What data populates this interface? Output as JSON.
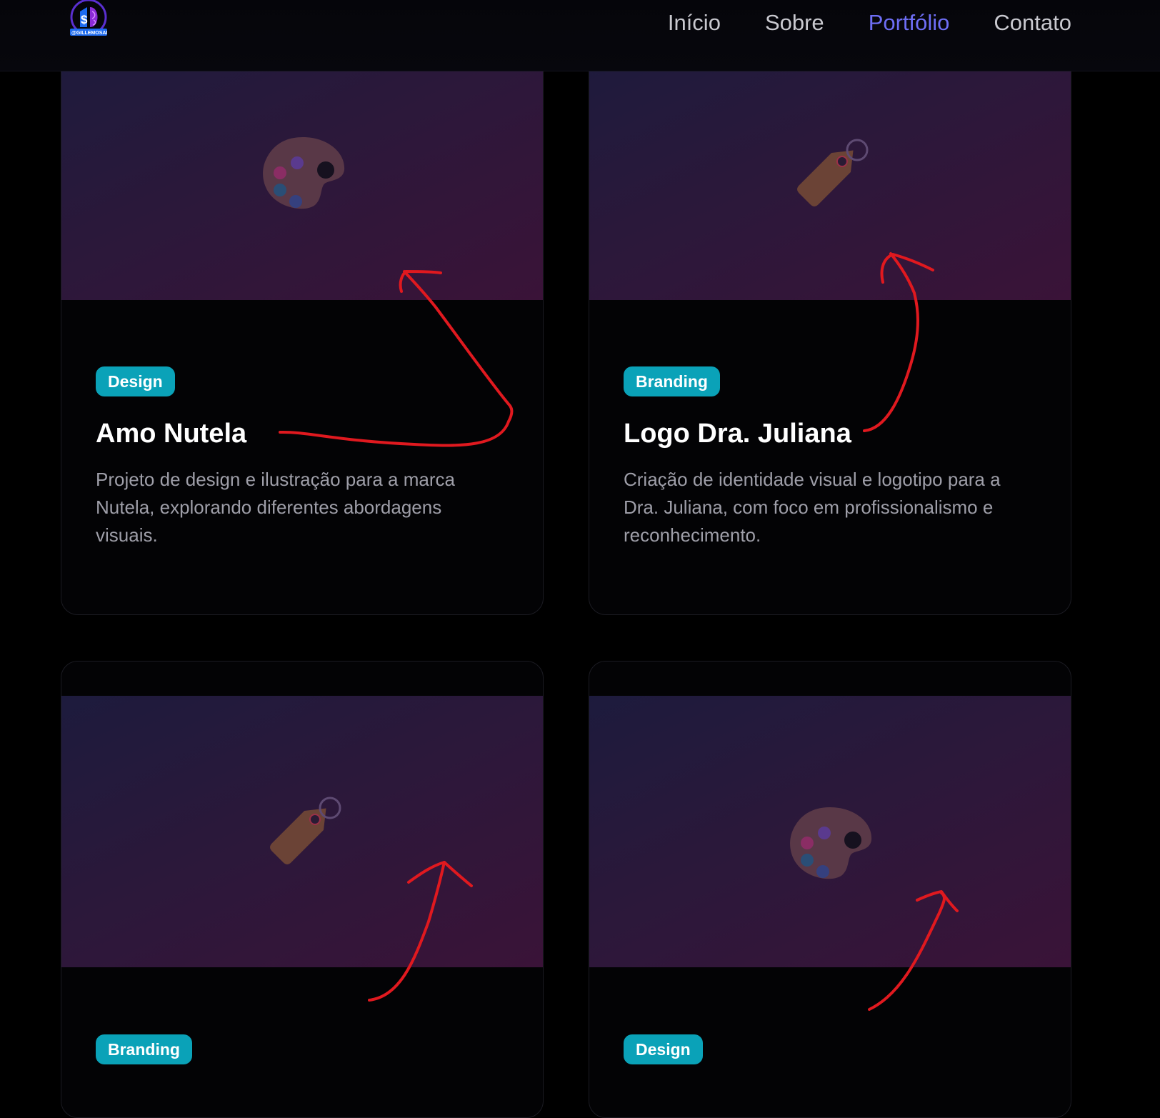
{
  "header": {
    "logo_text": "@GILLEMOSAI",
    "nav": [
      {
        "label": "Início",
        "active": false
      },
      {
        "label": "Sobre",
        "active": false
      },
      {
        "label": "Portfólio",
        "active": true
      },
      {
        "label": "Contato",
        "active": false
      }
    ]
  },
  "portfolio": {
    "cards": [
      {
        "icon": "palette-icon",
        "category": "Design",
        "title": "Amo Nutela",
        "description": "Projeto de design e ilustração para a marca Nutela, explorando diferentes abordagens visuais."
      },
      {
        "icon": "tag-icon",
        "category": "Branding",
        "title": "Logo Dra. Juliana",
        "description": "Criação de identidade visual e logotipo para a Dra. Juliana, com foco em profissionalismo e reconhecimento."
      },
      {
        "icon": "tag-icon",
        "category": "Branding",
        "title": "",
        "description": ""
      },
      {
        "icon": "palette-icon",
        "category": "Design",
        "title": "",
        "description": ""
      }
    ]
  },
  "colors": {
    "background": "#000000",
    "nav_active": "#6e6ef5",
    "badge": "#0aa2b8",
    "annotation_arrow": "#e0191f"
  }
}
